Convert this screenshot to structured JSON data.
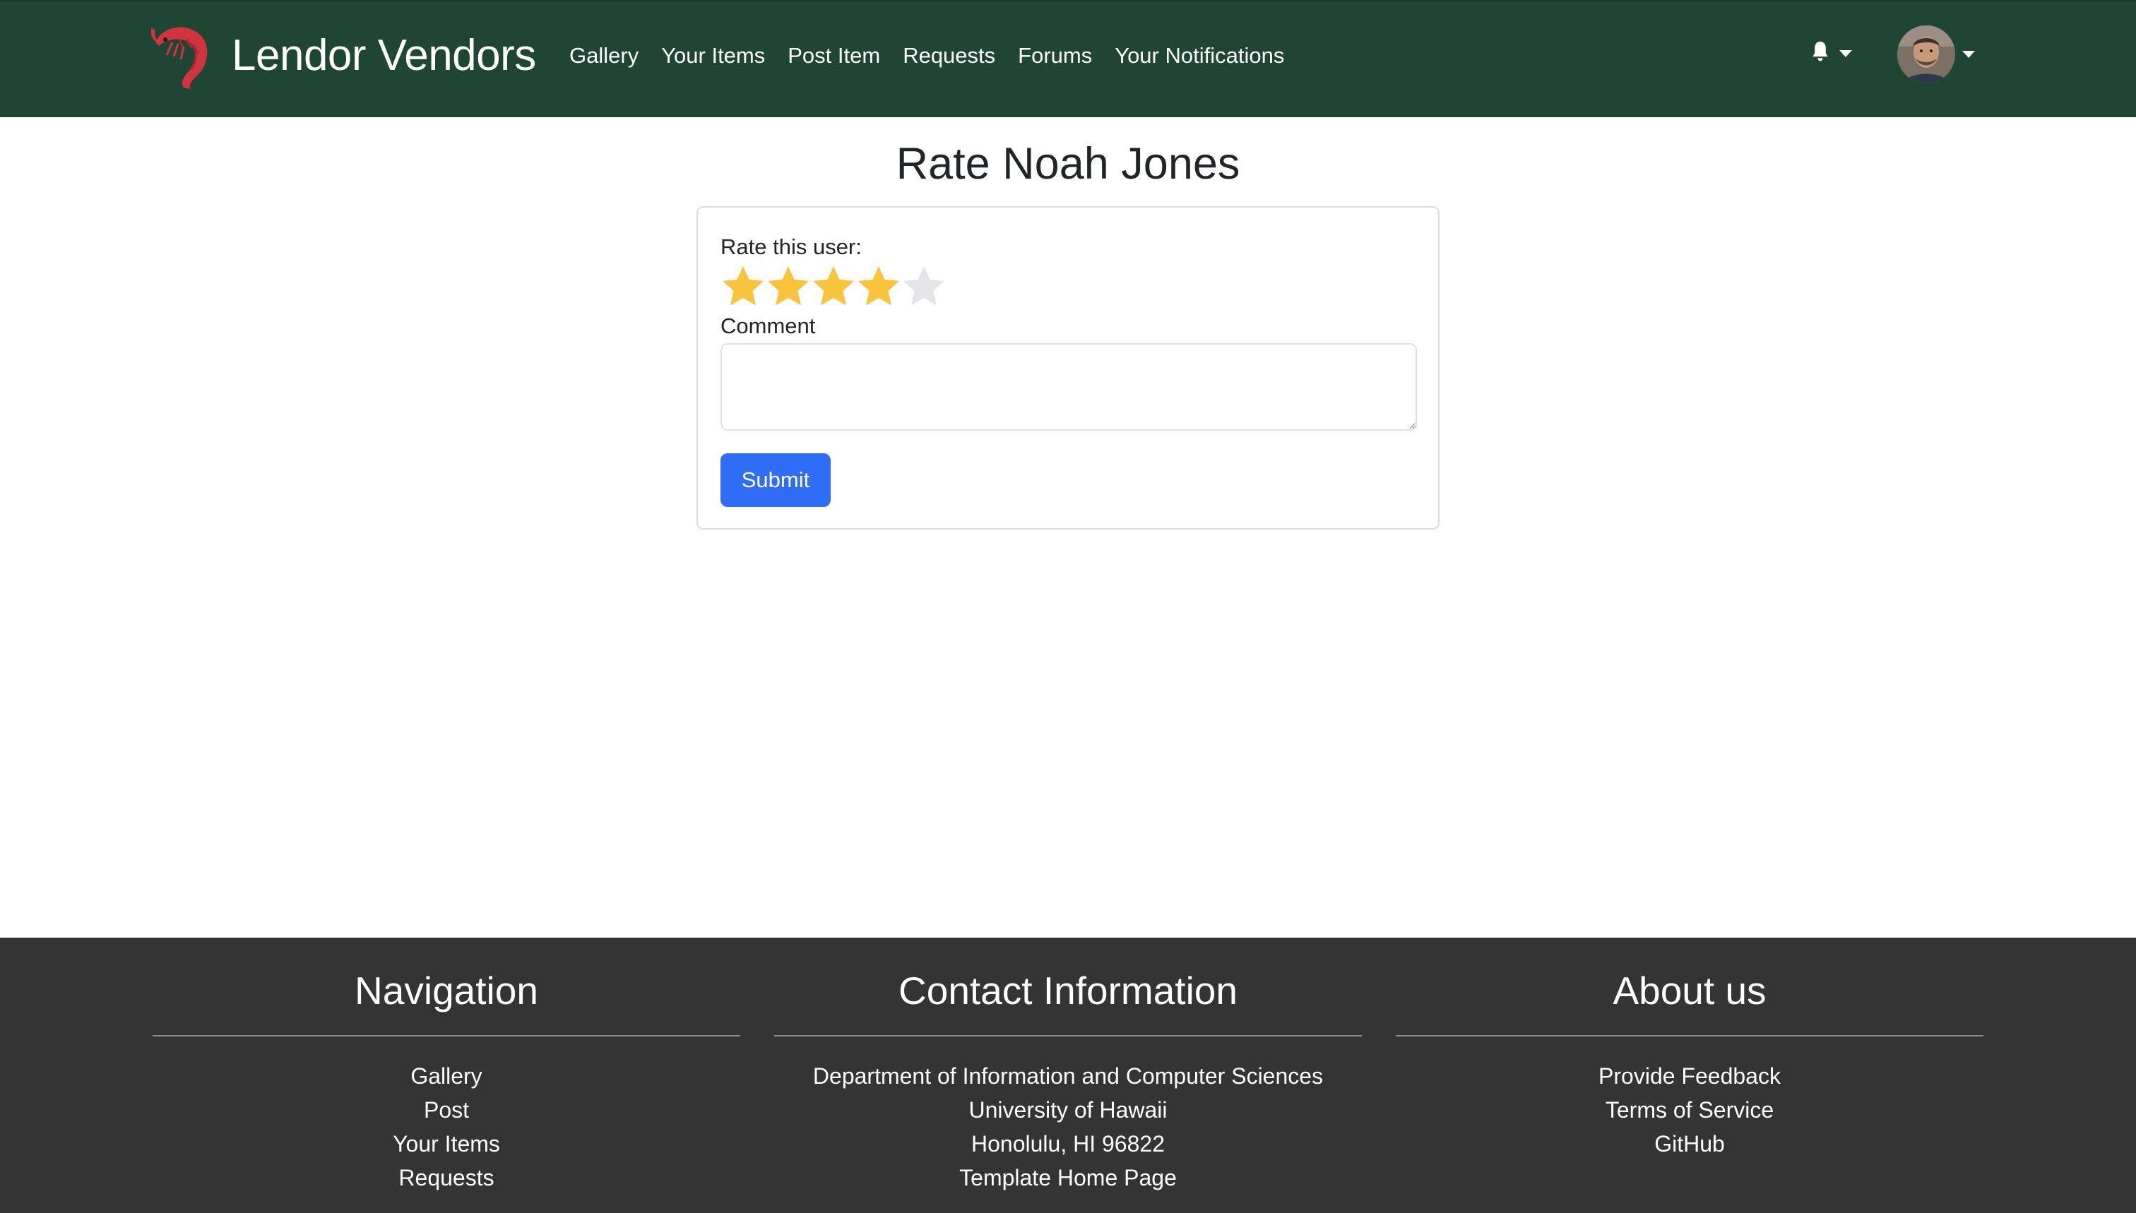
{
  "navbar": {
    "brand_name": "Lendor Vendors",
    "brand_logo_icon": "shrimp-icon",
    "links": [
      "Gallery",
      "Your Items",
      "Post Item",
      "Requests",
      "Forums",
      "Your Notifications"
    ],
    "notifications_icon": "bell-icon",
    "user_menu_icon": "avatar",
    "background_color": "#1e4632"
  },
  "main": {
    "title": "Rate Noah Jones",
    "rate_label": "Rate this user:",
    "rating": {
      "value": 4,
      "max": 5
    },
    "comment_label": "Comment",
    "comment_value": "",
    "submit_label": "Submit",
    "accent_color": "#2f6df6",
    "star_filled_color": "#f8c43c",
    "star_empty_color": "#e4e5e9"
  },
  "footer": {
    "navigation": {
      "heading": "Navigation",
      "items": [
        "Gallery",
        "Post",
        "Your Items",
        "Requests"
      ]
    },
    "contact": {
      "heading": "Contact Information",
      "lines": [
        "Department of Information and Computer Sciences",
        "University of Hawaii",
        "Honolulu, HI 96822",
        "Template Home Page"
      ]
    },
    "about": {
      "heading": "About us",
      "items": [
        "Provide Feedback",
        "Terms of Service",
        "GitHub"
      ]
    },
    "background_color": "#343434"
  }
}
